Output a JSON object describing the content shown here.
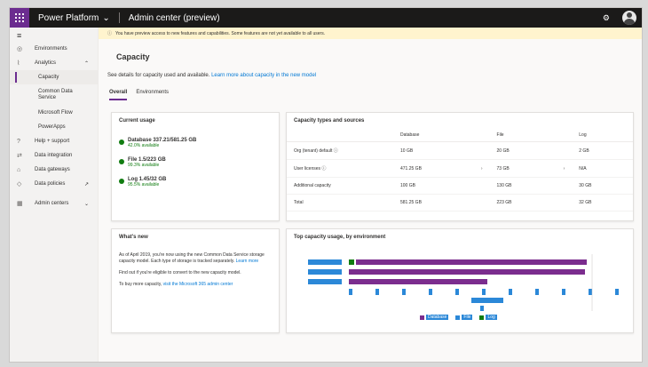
{
  "topbar": {
    "brand": "Power Platform",
    "title": "Admin center (preview)"
  },
  "sidebar": {
    "items": [
      {
        "label": "Environments",
        "icon": "globe-icon"
      },
      {
        "label": "Analytics",
        "icon": "chart-icon"
      },
      {
        "label": "Help + support",
        "icon": "help-icon"
      },
      {
        "label": "Data integration",
        "icon": "integration-icon"
      },
      {
        "label": "Data gateways",
        "icon": "gateway-icon"
      },
      {
        "label": "Data policies",
        "icon": "policy-icon"
      },
      {
        "label": "Admin centers",
        "icon": "admin-icon"
      }
    ],
    "sub": [
      "Capacity",
      "Common Data Service",
      "Microsoft Flow",
      "PowerApps"
    ]
  },
  "banner": "You have preview access to new features and capabilities. Some features are not yet available to all users.",
  "page": {
    "title": "Capacity",
    "subtitle_prefix": "See details for capacity used and available. ",
    "subtitle_link": "Learn more about capacity in the new model",
    "tabs": [
      "Overall",
      "Environments"
    ]
  },
  "current_usage": {
    "title": "Current usage",
    "rows": [
      {
        "main": "Database  337.21/581.25 GB",
        "sub": "42.0% available"
      },
      {
        "main": "File  1.5/223 GB",
        "sub": "99.3% available"
      },
      {
        "main": "Log  1.45/32 GB",
        "sub": "95.5% available"
      }
    ]
  },
  "whats_new": {
    "title": "What's new",
    "p1": "As of April 2019, you're now using the new Common Data Service storage capacity model. Each type of storage is tracked separately. ",
    "p1_link": "Learn more",
    "p2": "Find out if you're eligible to convert to the new capacity model.",
    "p3_prefix": "To buy more capacity, ",
    "p3_link": "visit the Microsoft 365 admin center"
  },
  "capacity_table": {
    "title": "Capacity types and sources",
    "headers": [
      "",
      "Database",
      "File",
      "Log"
    ],
    "rows": [
      [
        "Org (tenant) default",
        "10 GB",
        "20 GB",
        "2 GB"
      ],
      [
        "User licenses",
        "471.25 GB",
        "73 GB",
        "N/A"
      ],
      [
        "Additional capacity",
        "100 GB",
        "130 GB",
        "30 GB"
      ],
      [
        "Total",
        "581.25 GB",
        "223 GB",
        "32 GB"
      ]
    ]
  },
  "chart_data": {
    "type": "bar",
    "title": "Top capacity usage, by environment",
    "series": [
      {
        "name": "Database",
        "color": "#7b2d8e"
      },
      {
        "name": "File",
        "color": "#2b88d8"
      },
      {
        "name": "Log",
        "color": "#107c10"
      }
    ],
    "legend": "bottom"
  }
}
